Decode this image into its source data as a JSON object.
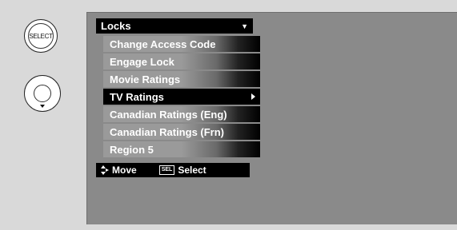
{
  "remote": {
    "select_button_label": "SELECT"
  },
  "menu": {
    "header_title": "Locks",
    "items": [
      {
        "label": "Change Access Code",
        "selected": false
      },
      {
        "label": "Engage Lock",
        "selected": false
      },
      {
        "label": "Movie Ratings",
        "selected": false
      },
      {
        "label": "TV Ratings",
        "selected": true
      },
      {
        "label": "Canadian Ratings (Eng)",
        "selected": false
      },
      {
        "label": "Canadian Ratings (Frn)",
        "selected": false
      },
      {
        "label": "Region 5",
        "selected": false
      }
    ]
  },
  "help_bar": {
    "move_label": "Move",
    "sel_key_label": "SEL",
    "select_label": "Select"
  },
  "icons": {
    "dropdown": "caret-down-icon",
    "submenu": "chevron-right-icon",
    "move": "up-down-arrows-icon"
  },
  "colors": {
    "screen_bg": "#8a8a8a",
    "menu_bg": "#000000",
    "text": "#ffffff"
  }
}
